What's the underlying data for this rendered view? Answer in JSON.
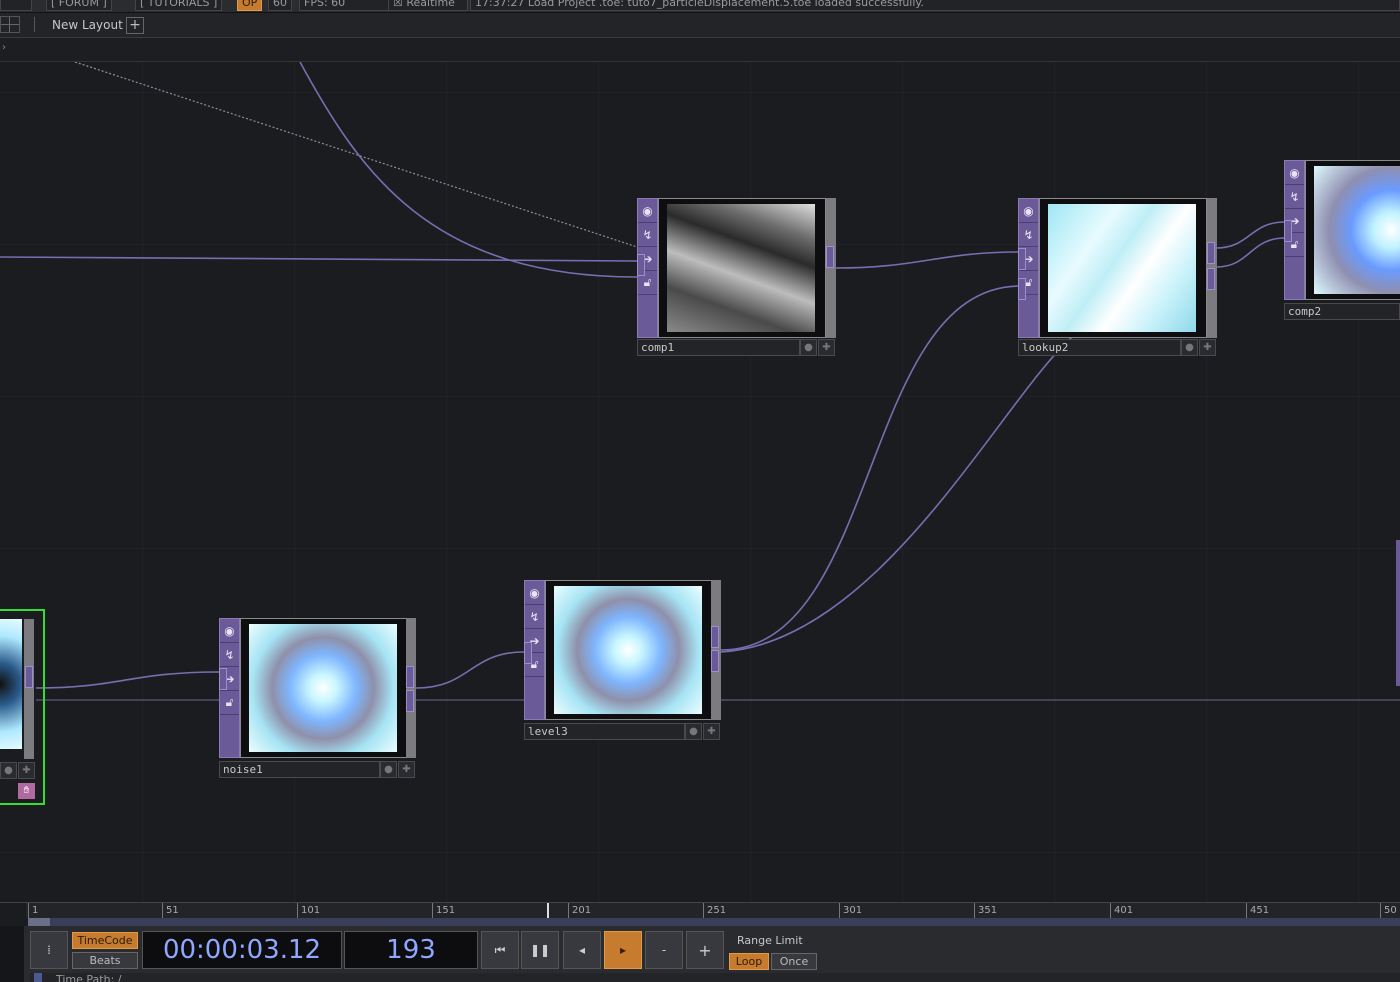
{
  "menu": {
    "forum": "[ FORUM ]",
    "tutorials": "[ TUTORIALS ]",
    "op_badge": "OP",
    "fps_target": "60",
    "fps": "FPS:  60",
    "realtime": "Realtime",
    "status": "17:37:27 Load Project .toe: tuto7_particleDisplacement.5.toe loaded successfully."
  },
  "layout": {
    "label": "New Layout",
    "add": "+"
  },
  "nodes": {
    "comp1": "comp1",
    "lookup2": "lookup2",
    "comp2": "comp2",
    "noise1": "noise1",
    "level3": "level3"
  },
  "ruler": [
    "1",
    "51",
    "101",
    "151",
    "201",
    "251",
    "301",
    "351",
    "401",
    "451",
    "50"
  ],
  "transport": {
    "timecode_mode": "TimeCode",
    "beats_mode": "Beats",
    "timecode": "00:00:03.12",
    "frame": "193",
    "range_limit": "Range Limit",
    "loop": "Loop",
    "once": "Once",
    "minus": "-",
    "plus": "+",
    "time_path": "Time Path: /"
  },
  "colors": {
    "op_purple": "#6b5a98",
    "wire": "#7a6cb0",
    "accent_orange": "#c67b2e",
    "timecode_blue": "#8fa8ff",
    "selection_green": "#33dd33"
  }
}
